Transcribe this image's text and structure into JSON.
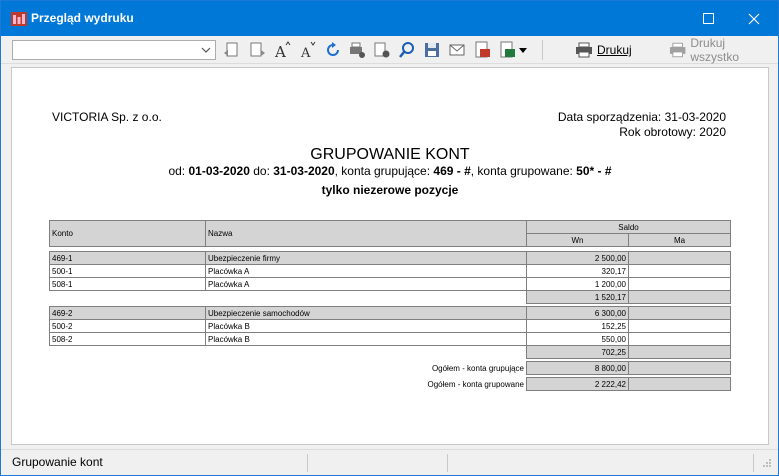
{
  "window": {
    "title": "Przegląd wydruku",
    "maximize_icon": "maximize-icon",
    "close_icon": "close-icon"
  },
  "toolbar": {
    "combo_value": "",
    "print_label": "Drukuj",
    "print_all_label": "Drukuj wszystko",
    "icons": [
      "zoom-in-page-icon",
      "zoom-out-page-icon",
      "font-increase-icon",
      "font-decrease-icon",
      "refresh-icon",
      "printer-settings-icon",
      "page-settings-icon",
      "search-icon",
      "save-icon",
      "mail-icon",
      "pdf-export-icon",
      "excel-export-icon",
      "dropdown-arrow-icon"
    ]
  },
  "report": {
    "company": "VICTORIA Sp. z o.o.",
    "date_line": "Data sporządzenia: 31-03-2020",
    "year_line": "Rok obrotowy: 2020",
    "title": "GRUPOWANIE KONT",
    "subtitle": {
      "from_label": "od:",
      "from": "01-03-2020",
      "to_label": "do:",
      "to": "31-03-2020",
      "grouping_label": ", konta grupujące:",
      "grouping": "469 - #",
      "grouped_label": ", konta grupowane:",
      "grouped": "50* - #"
    },
    "note": "tylko niezerowe pozycje",
    "headers": {
      "konto": "Konto",
      "nazwa": "Nazwa",
      "saldo": "Saldo",
      "wn": "Wn",
      "ma": "Ma"
    },
    "groups": [
      {
        "rows": [
          {
            "konto": "469-1",
            "nazwa": "Ubezpieczenie firmy",
            "wn": "2 500,00",
            "ma": ""
          },
          {
            "konto": "500-1",
            "nazwa": "Placówka A",
            "wn": "320,17",
            "ma": ""
          },
          {
            "konto": "508-1",
            "nazwa": "Placówka A",
            "wn": "1 200,00",
            "ma": ""
          }
        ],
        "subtotal_wn": "1 520,17",
        "subtotal_ma": ""
      },
      {
        "rows": [
          {
            "konto": "469-2",
            "nazwa": "Ubezpieczenie samochodów",
            "wn": "6 300,00",
            "ma": ""
          },
          {
            "konto": "500-2",
            "nazwa": "Placówka B",
            "wn": "152,25",
            "ma": ""
          },
          {
            "konto": "508-2",
            "nazwa": "Placówka B",
            "wn": "550,00",
            "ma": ""
          }
        ],
        "subtotal_wn": "702,25",
        "subtotal_ma": ""
      }
    ],
    "totals": [
      {
        "label": "Ogółem - konta grupujące",
        "wn": "8 800,00",
        "ma": ""
      },
      {
        "label": "Ogółem - konta grupowane",
        "wn": "2 222,42",
        "ma": ""
      }
    ]
  },
  "status": {
    "text": "Grupowanie kont"
  }
}
